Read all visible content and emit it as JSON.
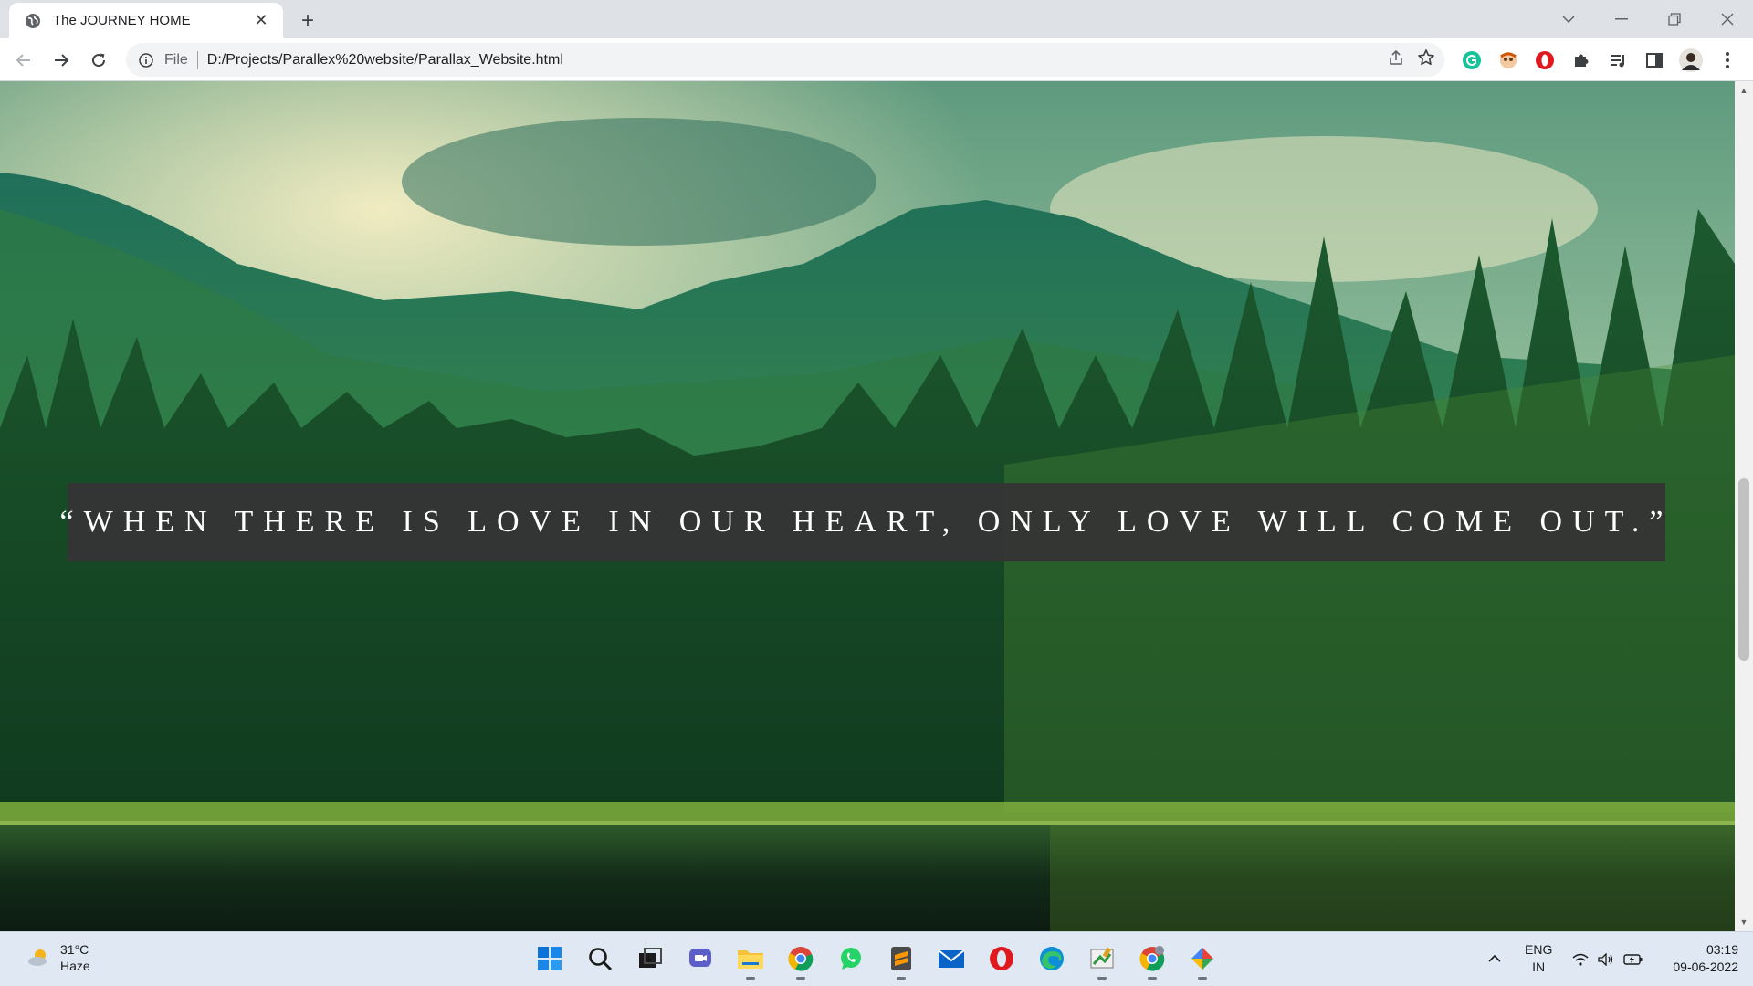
{
  "browser": {
    "tab": {
      "title": "The JOURNEY HOME",
      "close_glyph": "✕",
      "favicon": "globe-icon"
    },
    "new_tab_glyph": "+",
    "window_controls": {
      "tab_search": "⌄",
      "minimize": "—",
      "restore": "❐",
      "close": "✕"
    },
    "omnibox": {
      "scheme": "File",
      "url": "D:/Projects/Parallex%20website/Parallax_Website.html"
    }
  },
  "page": {
    "quote": "“WHEN THERE IS LOVE IN OUR HEART, ONLY LOVE WILL COME OUT.”",
    "overlay_color": "#343434",
    "scrollbar_progress": 0.6
  },
  "taskbar": {
    "weather": {
      "temp": "31°C",
      "condition": "Haze"
    },
    "apps": [
      "start-icon",
      "search-icon",
      "task-view-icon",
      "teams-chat-icon",
      "file-explorer-icon",
      "chrome-icon",
      "whatsapp-icon",
      "sublime-text-icon",
      "mail-icon",
      "opera-icon",
      "edge-icon",
      "paint-icon",
      "chrome-profile-icon",
      "gemini-icon"
    ],
    "language": {
      "line1": "ENG",
      "line2": "IN"
    },
    "clock": {
      "time": "03:19",
      "date": "09-06-2022"
    }
  }
}
